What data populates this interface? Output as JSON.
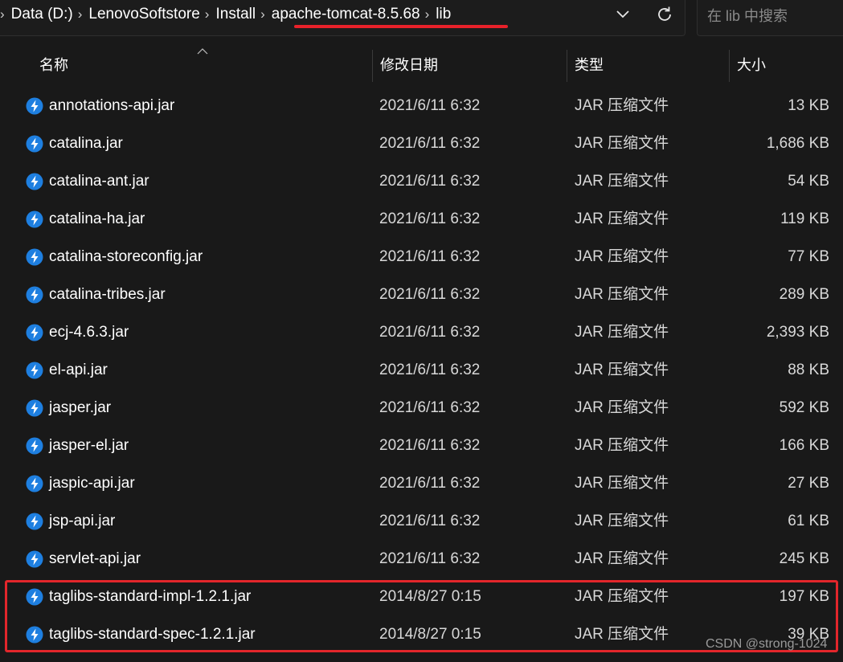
{
  "breadcrumb": {
    "items": [
      "Data (D:)",
      "LenovoSoftstore",
      "Install",
      "apache-tomcat-8.5.68",
      "lib"
    ]
  },
  "search": {
    "placeholder": "在 lib 中搜索"
  },
  "columns": {
    "name": "名称",
    "date": "修改日期",
    "type": "类型",
    "size": "大小"
  },
  "files": [
    {
      "name": "annotations-api.jar",
      "date": "2021/6/11 6:32",
      "type": "JAR 压缩文件",
      "size": "13 KB"
    },
    {
      "name": "catalina.jar",
      "date": "2021/6/11 6:32",
      "type": "JAR 压缩文件",
      "size": "1,686 KB"
    },
    {
      "name": "catalina-ant.jar",
      "date": "2021/6/11 6:32",
      "type": "JAR 压缩文件",
      "size": "54 KB"
    },
    {
      "name": "catalina-ha.jar",
      "date": "2021/6/11 6:32",
      "type": "JAR 压缩文件",
      "size": "119 KB"
    },
    {
      "name": "catalina-storeconfig.jar",
      "date": "2021/6/11 6:32",
      "type": "JAR 压缩文件",
      "size": "77 KB"
    },
    {
      "name": "catalina-tribes.jar",
      "date": "2021/6/11 6:32",
      "type": "JAR 压缩文件",
      "size": "289 KB"
    },
    {
      "name": "ecj-4.6.3.jar",
      "date": "2021/6/11 6:32",
      "type": "JAR 压缩文件",
      "size": "2,393 KB"
    },
    {
      "name": "el-api.jar",
      "date": "2021/6/11 6:32",
      "type": "JAR 压缩文件",
      "size": "88 KB"
    },
    {
      "name": "jasper.jar",
      "date": "2021/6/11 6:32",
      "type": "JAR 压缩文件",
      "size": "592 KB"
    },
    {
      "name": "jasper-el.jar",
      "date": "2021/6/11 6:32",
      "type": "JAR 压缩文件",
      "size": "166 KB"
    },
    {
      "name": "jaspic-api.jar",
      "date": "2021/6/11 6:32",
      "type": "JAR 压缩文件",
      "size": "27 KB"
    },
    {
      "name": "jsp-api.jar",
      "date": "2021/6/11 6:32",
      "type": "JAR 压缩文件",
      "size": "61 KB"
    },
    {
      "name": "servlet-api.jar",
      "date": "2021/6/11 6:32",
      "type": "JAR 压缩文件",
      "size": "245 KB"
    },
    {
      "name": "taglibs-standard-impl-1.2.1.jar",
      "date": "2014/8/27 0:15",
      "type": "JAR 压缩文件",
      "size": "197 KB"
    },
    {
      "name": "taglibs-standard-spec-1.2.1.jar",
      "date": "2014/8/27 0:15",
      "type": "JAR 压缩文件",
      "size": "39 KB"
    }
  ],
  "watermark": "CSDN @strong-1024",
  "icons": {
    "file": "jar-file-icon",
    "dropdown": "chevron-down-icon",
    "refresh": "refresh-icon",
    "sort": "sort-ascending-icon"
  },
  "colors": {
    "background": "#191919",
    "icon_blue": "#1e7fe0",
    "annotation_red": "#e3262b"
  }
}
